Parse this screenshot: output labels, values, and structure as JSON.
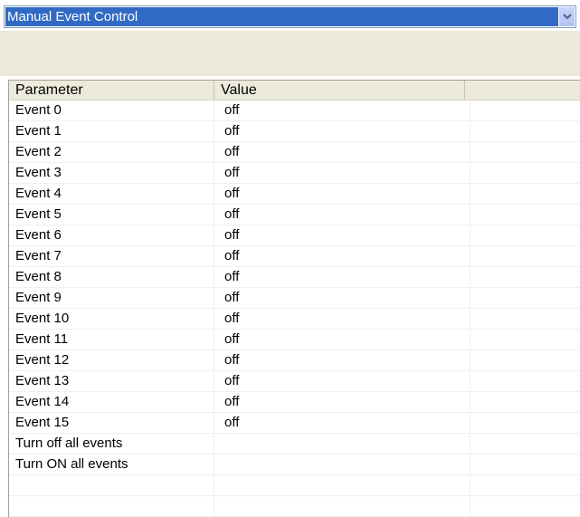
{
  "combo": {
    "selected": "Manual Event Control",
    "arrow_icon": "chevron-down-icon"
  },
  "grid": {
    "columns": [
      "Parameter",
      "Value",
      ""
    ],
    "rows": [
      {
        "parameter": "Event 0",
        "value": "off"
      },
      {
        "parameter": "Event 1",
        "value": "off"
      },
      {
        "parameter": "Event 2",
        "value": "off"
      },
      {
        "parameter": "Event 3",
        "value": "off"
      },
      {
        "parameter": "Event 4",
        "value": "off"
      },
      {
        "parameter": "Event 5",
        "value": "off"
      },
      {
        "parameter": "Event 6",
        "value": "off"
      },
      {
        "parameter": "Event 7",
        "value": "off"
      },
      {
        "parameter": "Event 8",
        "value": "off"
      },
      {
        "parameter": "Event 9",
        "value": "off"
      },
      {
        "parameter": "Event 10",
        "value": "off"
      },
      {
        "parameter": "Event 11",
        "value": "off"
      },
      {
        "parameter": "Event 12",
        "value": "off"
      },
      {
        "parameter": "Event 13",
        "value": "off"
      },
      {
        "parameter": "Event 14",
        "value": "off"
      },
      {
        "parameter": "Event 15",
        "value": "off"
      },
      {
        "parameter": "Turn off all events",
        "value": ""
      },
      {
        "parameter": "Turn ON all events",
        "value": ""
      },
      {
        "parameter": "",
        "value": ""
      },
      {
        "parameter": "",
        "value": ""
      }
    ]
  },
  "colors": {
    "selection": "#316ac5",
    "band": "#ece9d8",
    "header": "#ebeadb"
  }
}
